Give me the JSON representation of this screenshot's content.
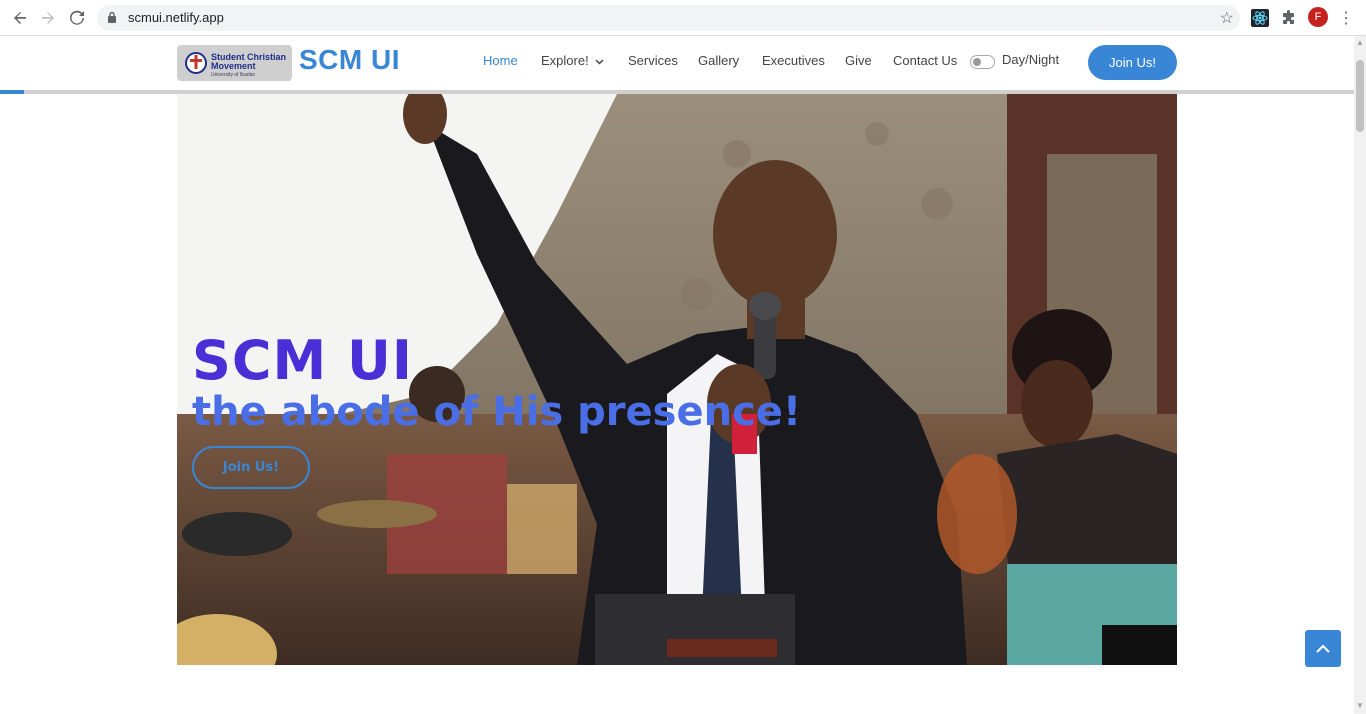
{
  "browser": {
    "url": "scmui.netlify.app",
    "profile_initial": "F",
    "icons": [
      "back-arrow-icon",
      "forward-arrow-icon",
      "reload-icon",
      "lock-icon",
      "star-icon",
      "react-devtools-icon",
      "extensions-puzzle-icon",
      "menu-dots-icon"
    ]
  },
  "header": {
    "logo": {
      "line1": "Student Christian",
      "line2": "Movement",
      "line3": "University of Ibadan"
    },
    "brand": "SCM UI",
    "nav": [
      {
        "label": "Home",
        "active": true
      },
      {
        "label": "Explore!",
        "dropdown": true
      },
      {
        "label": "Services"
      },
      {
        "label": "Gallery"
      },
      {
        "label": "Executives"
      },
      {
        "label": "Give"
      },
      {
        "label": "Contact Us"
      }
    ],
    "toggle_label": "Day/Night",
    "join_label": "Join Us!",
    "scroll_progress": 0.018
  },
  "hero": {
    "title": "SCM UI",
    "tagline": "the abode of His presence!",
    "join_label": "Join Us!"
  },
  "colors": {
    "accent": "#3a86d6",
    "hero_title": "#4a2fd6",
    "hero_tagline": "#4a6ee6"
  }
}
